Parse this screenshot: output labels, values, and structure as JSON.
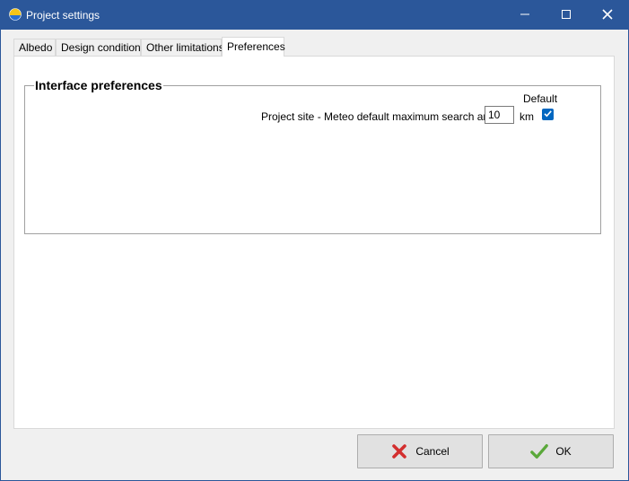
{
  "window": {
    "title": "Project settings",
    "app_icon": "sun-globe-icon"
  },
  "titlebar_buttons": {
    "minimize_icon": "minimize-icon",
    "maximize_icon": "maximize-icon",
    "close_icon": "close-icon"
  },
  "tabs": [
    {
      "label": "Albedo",
      "active": false
    },
    {
      "label": "Design conditions",
      "active": false
    },
    {
      "label": "Other limitations",
      "active": false
    },
    {
      "label": "Preferences",
      "active": true
    }
  ],
  "interface_preferences": {
    "group_title": "Interface preferences",
    "default_header": "Default",
    "meteo_search": {
      "label": "Project site - Meteo default maximum search area",
      "value": "10",
      "unit": "km",
      "default_checked": true
    }
  },
  "buttons": {
    "cancel_label": "Cancel",
    "ok_label": "OK"
  },
  "colors": {
    "titlebar": "#2b579a",
    "checkbox_accent": "#0067c0",
    "cancel_icon": "#d32f2f",
    "ok_icon": "#5aa83a"
  }
}
